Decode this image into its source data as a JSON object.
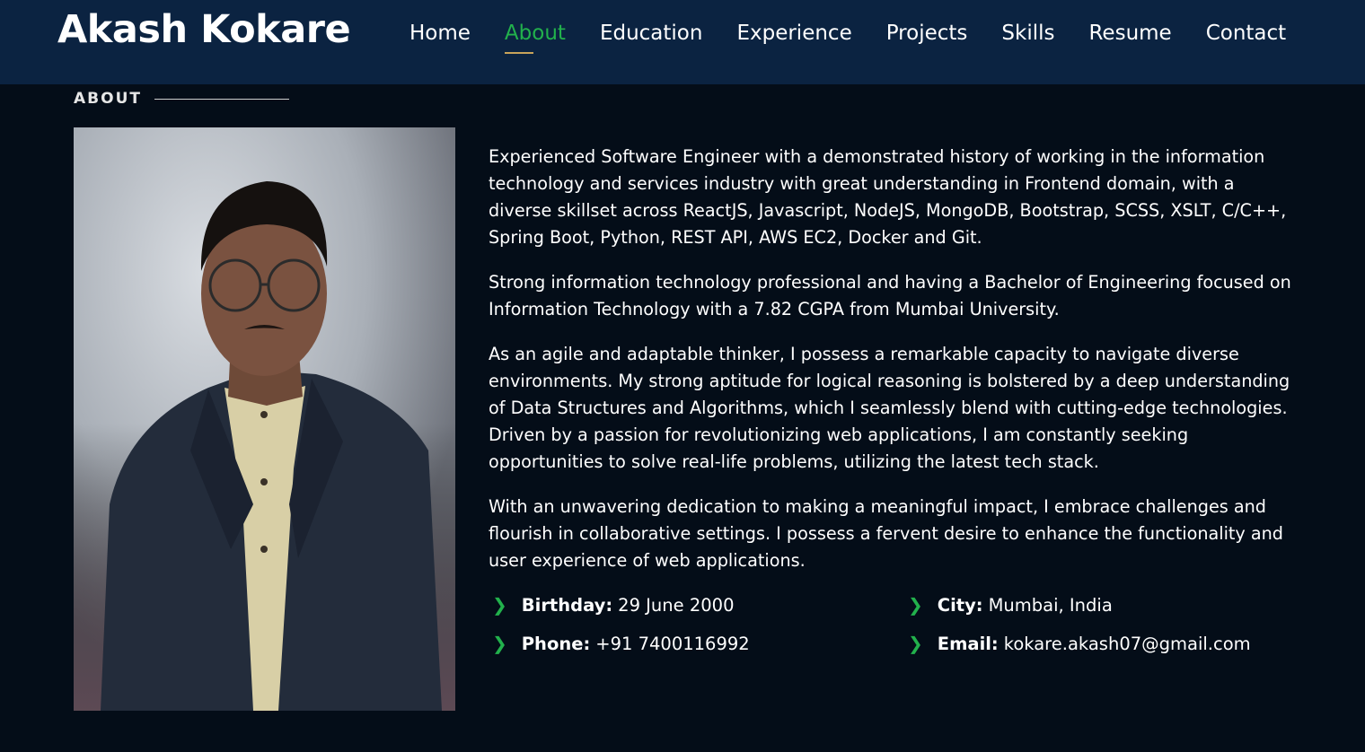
{
  "header": {
    "brand": "Akash Kokare",
    "nav": [
      "Home",
      "About",
      "Education",
      "Experience",
      "Projects",
      "Skills",
      "Resume",
      "Contact"
    ],
    "active_nav": "About",
    "accent_color": "#22b14c"
  },
  "about": {
    "section_title": "ABOUT",
    "paragraphs": [
      "Experienced Software Engineer with a demonstrated history of working in the information technology and services industry with great understanding in Frontend domain, with a diverse skillset across ReactJS, Javascript, NodeJS, MongoDB, Bootstrap, SCSS, XSLT, C/C++, Spring Boot, Python, REST API, AWS EC2, Docker and Git.",
      "Strong information technology professional and having a Bachelor of Engineering focused on Information Technology with a 7.82 CGPA from Mumbai University.",
      "As an agile and adaptable thinker, I possess a remarkable capacity to navigate diverse environments. My strong aptitude for logical reasoning is bolstered by a deep understanding of Data Structures and Algorithms, which I seamlessly blend with cutting-edge technologies. Driven by a passion for revolutionizing web applications, I am constantly seeking opportunities to solve real-life problems, utilizing the latest tech stack.",
      "With an unwavering dedication to making a meaningful impact, I embrace challenges and flourish in collaborative settings. I possess a fervent desire to enhance the functionality and user experience of web applications."
    ],
    "details": {
      "birthday_label": "Birthday:",
      "birthday": "29 June 2000",
      "city_label": "City:",
      "city": "Mumbai, India",
      "phone_label": "Phone:",
      "phone": "+91 7400116992",
      "email_label": "Email:",
      "email": "kokare.akash07@gmail.com"
    }
  }
}
